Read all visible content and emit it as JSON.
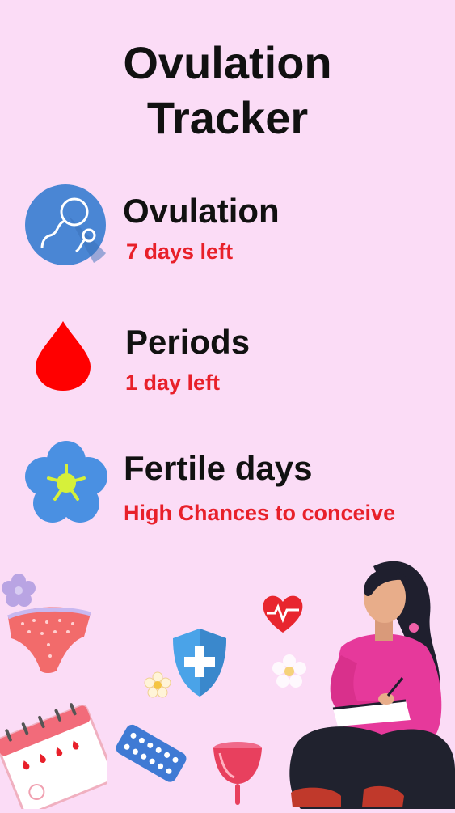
{
  "title": {
    "line1": "Ovulation",
    "line2": "Tracker"
  },
  "features": [
    {
      "name": "Ovulation",
      "detail": "7 days left",
      "icon": "sperm-icon"
    },
    {
      "name": "Periods",
      "detail": "1 day left",
      "icon": "blood-drop-icon"
    },
    {
      "name": "Fertile days",
      "detail": "High Chances to conceive",
      "icon": "flower-icon"
    }
  ],
  "colors": {
    "background": "#fbdcf6",
    "heading": "#111111",
    "accent_red": "#e8202a",
    "icon_blue": "#4a86d4",
    "flower_blue": "#4a90e2",
    "flower_center": "#d6f03a"
  },
  "illustrations": [
    "small-flower-icon",
    "underwear-icon",
    "heart-pulse-icon",
    "medical-shield-icon",
    "daisy-icon",
    "calendar-icon",
    "pill-pack-icon",
    "menstrual-cup-icon",
    "woman-writing-illustration"
  ]
}
